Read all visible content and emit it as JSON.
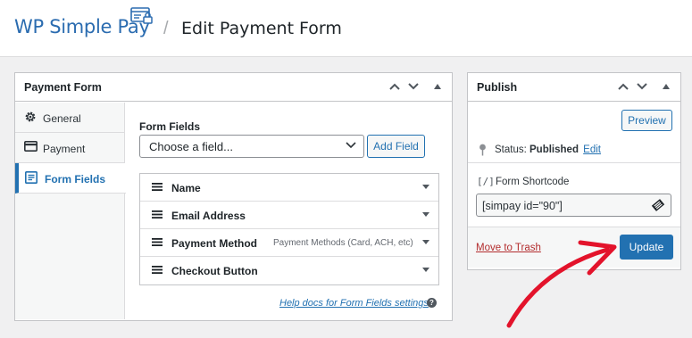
{
  "header": {
    "brand": "WP Simple Pay",
    "separator": "/",
    "page_title": "Edit Payment Form"
  },
  "payment_form_panel": {
    "title": "Payment Form",
    "tabs": [
      {
        "label": "General",
        "icon": "gear-icon"
      },
      {
        "label": "Payment",
        "icon": "credit-card-icon"
      },
      {
        "label": "Form Fields",
        "icon": "form-icon",
        "active": true
      }
    ],
    "form_fields_label": "Form Fields",
    "select_value": "Choose a field...",
    "add_field_label": "Add Field",
    "fields": [
      {
        "name": "Name",
        "description": ""
      },
      {
        "name": "Email Address",
        "description": ""
      },
      {
        "name": "Payment Method",
        "description": "Payment Methods (Card, ACH, etc)"
      },
      {
        "name": "Checkout Button",
        "description": ""
      }
    ],
    "help_link": "Help docs for Form Fields settings",
    "help_icon": "?"
  },
  "publish_panel": {
    "title": "Publish",
    "preview_label": "Preview",
    "status_prefix": "Status:",
    "status_value": "Published",
    "status_edit": "Edit",
    "shortcode_icon": "[/]",
    "shortcode_label": "Form Shortcode",
    "shortcode_value": "[simpay id=\"90\"]",
    "move_to_trash": "Move to Trash",
    "update_label": "Update"
  },
  "colors": {
    "accent": "#2271b1",
    "brand": "#2b6cb0",
    "danger": "#b32d2e",
    "annotation_arrow": "#e3132b"
  }
}
